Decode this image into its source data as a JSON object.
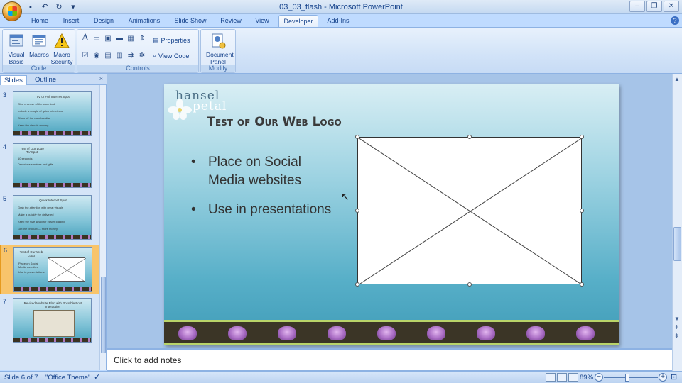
{
  "window": {
    "title": "03_03_flash - Microsoft PowerPoint"
  },
  "qat": {
    "save_icon": "save-icon",
    "undo_icon": "undo-icon",
    "redo_icon": "redo-icon"
  },
  "ribbon_tabs": [
    "Home",
    "Insert",
    "Design",
    "Animations",
    "Slide Show",
    "Review",
    "View",
    "Developer",
    "Add-Ins"
  ],
  "active_tab": "Developer",
  "ribbon": {
    "code_group": {
      "label": "Code",
      "visual_basic": "Visual Basic",
      "macros": "Macros",
      "macro_security": "Macro Security"
    },
    "controls_group": {
      "label": "Controls",
      "properties": "Properties",
      "view_code": "View Code"
    },
    "modify_group": {
      "label": "Modify",
      "document_panel": "Document Panel"
    }
  },
  "left_pane": {
    "tabs": [
      "Slides",
      "Outline"
    ],
    "active_tab": "Slides",
    "close": "×",
    "thumbnails": [
      {
        "number": "3",
        "title": "TV or Full Internet Spot",
        "lines": [
          "Give a sense of the store look",
          "Include a couple of quick interviews",
          "Show off the merchandise",
          "Keep the visuals moving"
        ]
      },
      {
        "number": "4",
        "title": "Test of Our Logo TV Spot",
        "lines": [
          "10 seconds",
          "Describes services and gifts"
        ]
      },
      {
        "number": "5",
        "title": "Quick Internet Spot",
        "lines": [
          "Grab the attention with great visuals",
          "Make a quickly the delivered",
          "Keep the size small for easier loading",
          "Get the product — more money"
        ]
      },
      {
        "number": "6",
        "title": "Test of Our Web Logo",
        "lines": [
          "Place on Social Media websites",
          "Use in presentations"
        ],
        "selected": true
      },
      {
        "number": "7",
        "title": "Revised Website Plan with Possible Post Interaction",
        "lines": []
      }
    ]
  },
  "slide": {
    "logo_top": "hansel",
    "logo_bottom": "petal",
    "title": "Test of Our Web Logo",
    "bullets": [
      "Place on Social Media websites",
      "Use in presentations"
    ]
  },
  "notes": {
    "placeholder": "Click to add notes"
  },
  "status": {
    "slide_info": "Slide 6 of 7",
    "theme": "\"Office Theme\"",
    "zoom": "89%"
  },
  "colors": {
    "ribbon": "#dfeaf8",
    "accent": "#15428b",
    "selected_thumb": "#f8c46b"
  }
}
